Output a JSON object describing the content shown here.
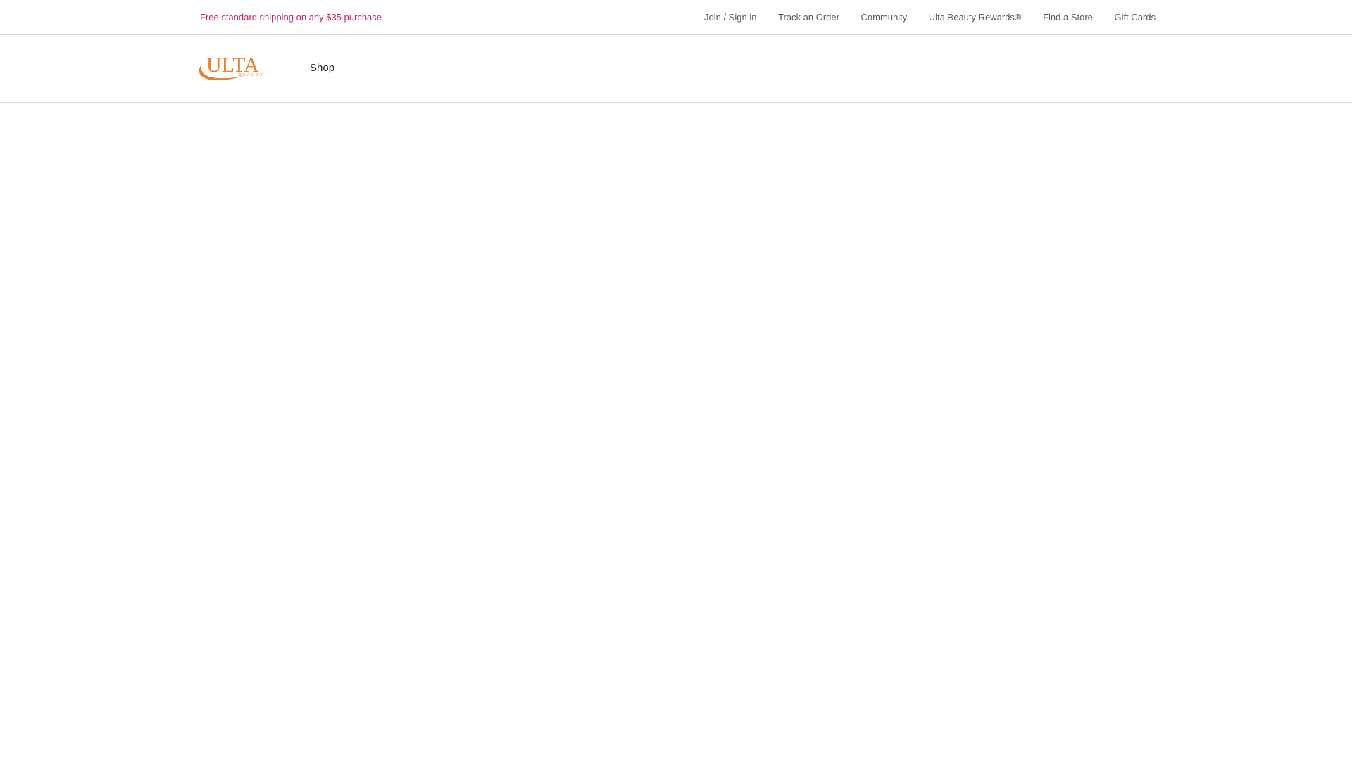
{
  "colors": {
    "promo": "#c4236d",
    "brand": "#e5822b",
    "link": "#595959",
    "divider": "#d5d5d5"
  },
  "utility_bar": {
    "promo": "Free standard shipping on any $35 purchase",
    "links": [
      "Join / Sign in",
      "Track an Order",
      "Community",
      "Ulta Beauty Rewards®",
      "Find a Store",
      "Gift Cards"
    ]
  },
  "header": {
    "logo": {
      "primary_text": "ULTA",
      "secondary_text": "BEAUTY"
    },
    "nav": {
      "shop_label": "Shop"
    }
  }
}
